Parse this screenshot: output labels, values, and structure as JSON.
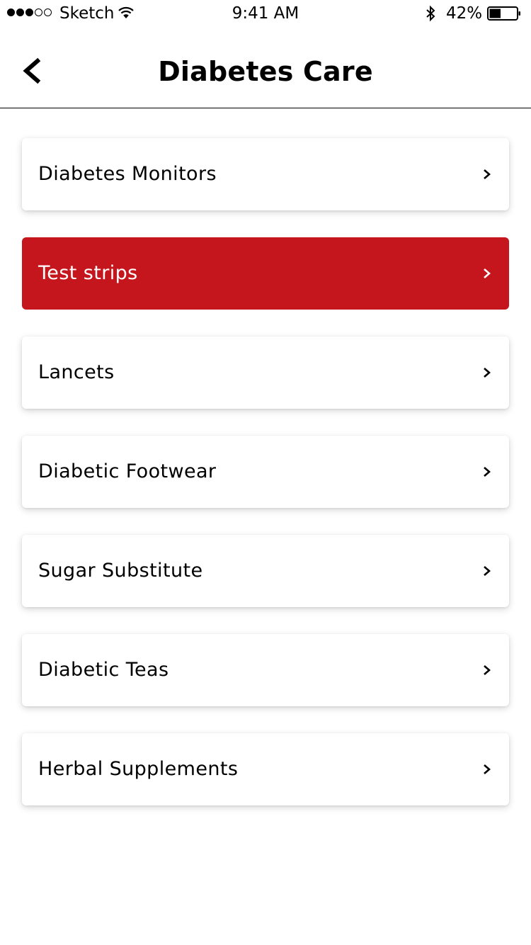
{
  "status_bar": {
    "signal_filled": 3,
    "signal_total": 5,
    "carrier": "Sketch",
    "time": "9:41 AM",
    "battery_percent": "42%",
    "battery_level": 0.42
  },
  "header": {
    "back_icon": "chevron-left-icon",
    "title": "Diabetes Care"
  },
  "colors": {
    "accent": "#c4161c",
    "background": "#ffffff",
    "text": "#000000"
  },
  "categories": [
    {
      "label": "Diabetes Monitors",
      "active": false
    },
    {
      "label": "Test strips",
      "active": true
    },
    {
      "label": "Lancets",
      "active": false
    },
    {
      "label": "Diabetic Footwear",
      "active": false
    },
    {
      "label": "Sugar Substitute",
      "active": false
    },
    {
      "label": "Diabetic Teas",
      "active": false
    },
    {
      "label": "Herbal Supplements",
      "active": false
    }
  ]
}
